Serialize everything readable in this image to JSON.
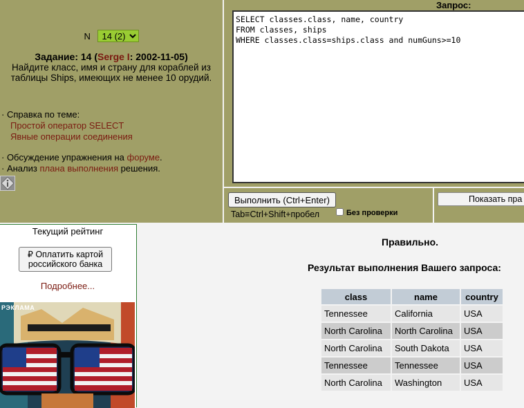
{
  "task": {
    "n_label": "N",
    "n_selected": "14 (2)",
    "title_prefix": "Задание: 14 (",
    "author": "Serge I",
    "title_suffix": ": 2002-11-05)",
    "text": "Найдите класс, имя и страну для кораблей из таблицы Ships, имеющих не менее 10 орудий."
  },
  "help": {
    "heading": "· Справка по теме:",
    "links": [
      "Простой оператор SELECT",
      "Явные операции соединения"
    ]
  },
  "discuss": {
    "line1_prefix": "· Обсуждение упражнения на ",
    "line1_link": "форуме",
    "line1_suffix": ".",
    "line2_prefix": "· Анализ ",
    "line2_link": "плана выполнения",
    "line2_suffix": " решения."
  },
  "query": {
    "label": "Запрос:",
    "text": "SELECT classes.class, name, country\nFROM classes, ships\nWHERE classes.class=ships.class and numGuns>=10"
  },
  "actions": {
    "run_label": "Выполнить (Ctrl+Enter)",
    "hint": "Tab≡Ctrl+Shift+пробел",
    "nocheck_label": "Без проверки",
    "plan_label": "Показать пра"
  },
  "sidebar": {
    "rating_label": "Текущий рейтинг",
    "pay_label": "₽ Оплатить картой российского банка",
    "more_label": "Подробнее...",
    "ad_label": "РЭКЛАМА"
  },
  "result": {
    "status": "Правильно.",
    "title": "Результат выполнения Вашего запроса:",
    "columns": [
      "class",
      "name",
      "country"
    ],
    "rows": [
      [
        "Tennessee",
        "California",
        "USA"
      ],
      [
        "North Carolina",
        "North Carolina",
        "USA"
      ],
      [
        "North Carolina",
        "South Dakota",
        "USA"
      ],
      [
        "Tennessee",
        "Tennessee",
        "USA"
      ],
      [
        "North Carolina",
        "Washington",
        "USA"
      ]
    ]
  },
  "icons": {
    "info": "info-icon",
    "ad_image": "sunglasses-flag-image"
  },
  "colors": {
    "panel": "#a09f67",
    "link": "#7a1a10",
    "select_bg": "#99cc33",
    "header_bg": "#c2ccd6"
  }
}
